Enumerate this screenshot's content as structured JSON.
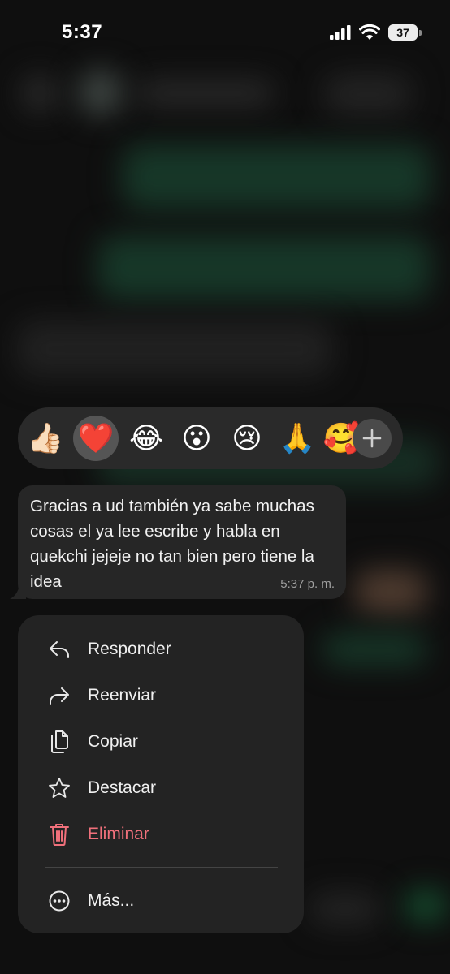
{
  "status_bar": {
    "time": "5:37",
    "battery": "37"
  },
  "reactions": [
    {
      "emoji": "👍🏻",
      "icon": "thumbs-up-icon",
      "selected": false
    },
    {
      "emoji": "❤️",
      "icon": "heart-icon",
      "selected": true
    },
    {
      "emoji": "😂",
      "icon": "laughing-icon",
      "selected": false
    },
    {
      "emoji": "😮",
      "icon": "surprised-icon",
      "selected": false
    },
    {
      "emoji": "😢",
      "icon": "crying-icon",
      "selected": false
    },
    {
      "emoji": "🙏",
      "icon": "praying-hands-icon",
      "selected": false
    },
    {
      "emoji": "🥰",
      "icon": "smiling-hearts-icon",
      "selected": false
    }
  ],
  "message": {
    "text": "Gracias a ud también ya sabe muchas cosas el ya lee escribe y habla en quekchi jejeje no tan bien pero tiene la idea",
    "timestamp": "5:37 p. m."
  },
  "menu": {
    "reply": "Responder",
    "forward": "Reenviar",
    "copy": "Copiar",
    "star": "Destacar",
    "delete": "Eliminar",
    "more": "Más..."
  },
  "colors": {
    "danger": "#f0707b",
    "menu_bg": "#232323",
    "bubble_bg": "#262626"
  }
}
